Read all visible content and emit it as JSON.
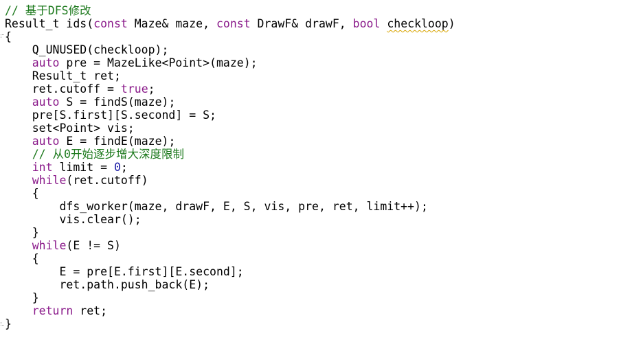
{
  "editor": {
    "colors": {
      "background": "#ffffff",
      "text": "#000000",
      "keyword": "#8a1a8a",
      "number": "#1a1aa6",
      "comment": "#1e7a1e",
      "warning_underline": "#d8a300"
    },
    "lines": [
      [
        {
          "t": "// 基于DFS修改",
          "c": "comment"
        }
      ],
      [
        {
          "t": "Result_t ids(",
          "c": "plain"
        },
        {
          "t": "const",
          "c": "keyword"
        },
        {
          "t": " Maze& maze, ",
          "c": "plain"
        },
        {
          "t": "const",
          "c": "keyword"
        },
        {
          "t": " DrawF& drawF, ",
          "c": "plain"
        },
        {
          "t": "bool",
          "c": "keyword"
        },
        {
          "t": " ",
          "c": "plain"
        },
        {
          "t": "checkloop",
          "c": "plain",
          "warn": true
        },
        {
          "t": ")",
          "c": "plain"
        }
      ],
      [
        {
          "t": "{",
          "c": "plain"
        }
      ],
      [
        {
          "t": "    Q_UNUSED(checkloop);",
          "c": "plain"
        }
      ],
      [
        {
          "t": "    ",
          "c": "plain"
        },
        {
          "t": "auto",
          "c": "keyword"
        },
        {
          "t": " pre = MazeLike<Point>(maze);",
          "c": "plain"
        }
      ],
      [
        {
          "t": "    Result_t ret;",
          "c": "plain"
        }
      ],
      [
        {
          "t": "    ret.cutoff = ",
          "c": "plain"
        },
        {
          "t": "true",
          "c": "keyword"
        },
        {
          "t": ";",
          "c": "plain"
        }
      ],
      [
        {
          "t": "    ",
          "c": "plain"
        },
        {
          "t": "auto",
          "c": "keyword"
        },
        {
          "t": " S = findS(maze);",
          "c": "plain"
        }
      ],
      [
        {
          "t": "    pre[S.first][S.second] = S;",
          "c": "plain"
        }
      ],
      [
        {
          "t": "    set<Point> vis;",
          "c": "plain"
        }
      ],
      [
        {
          "t": "    ",
          "c": "plain"
        },
        {
          "t": "auto",
          "c": "keyword"
        },
        {
          "t": " E = findE(maze);",
          "c": "plain"
        }
      ],
      [
        {
          "t": "    // 从0开始逐步增大深度限制",
          "c": "comment"
        }
      ],
      [
        {
          "t": "    ",
          "c": "plain"
        },
        {
          "t": "int",
          "c": "keyword"
        },
        {
          "t": " limit = ",
          "c": "plain"
        },
        {
          "t": "0",
          "c": "number"
        },
        {
          "t": ";",
          "c": "plain"
        }
      ],
      [
        {
          "t": "    ",
          "c": "plain"
        },
        {
          "t": "while",
          "c": "keyword"
        },
        {
          "t": "(ret.cutoff)",
          "c": "plain"
        }
      ],
      [
        {
          "t": "    {",
          "c": "plain"
        }
      ],
      [
        {
          "t": "        dfs_worker(maze, drawF, E, S, vis, pre, ret, limit++);",
          "c": "plain"
        }
      ],
      [
        {
          "t": "        vis.clear();",
          "c": "plain"
        }
      ],
      [
        {
          "t": "    }",
          "c": "plain"
        }
      ],
      [
        {
          "t": "    ",
          "c": "plain"
        },
        {
          "t": "while",
          "c": "keyword"
        },
        {
          "t": "(E != S)",
          "c": "plain"
        }
      ],
      [
        {
          "t": "    {",
          "c": "plain"
        }
      ],
      [
        {
          "t": "        E = pre[E.first][E.second];",
          "c": "plain"
        }
      ],
      [
        {
          "t": "        ret.path.push_back(E);",
          "c": "plain"
        }
      ],
      [
        {
          "t": "    }",
          "c": "plain"
        }
      ],
      [
        {
          "t": "    ",
          "c": "plain"
        },
        {
          "t": "return",
          "c": "keyword"
        },
        {
          "t": " ret;",
          "c": "plain"
        }
      ],
      [
        {
          "t": "}",
          "c": "plain"
        }
      ]
    ]
  }
}
